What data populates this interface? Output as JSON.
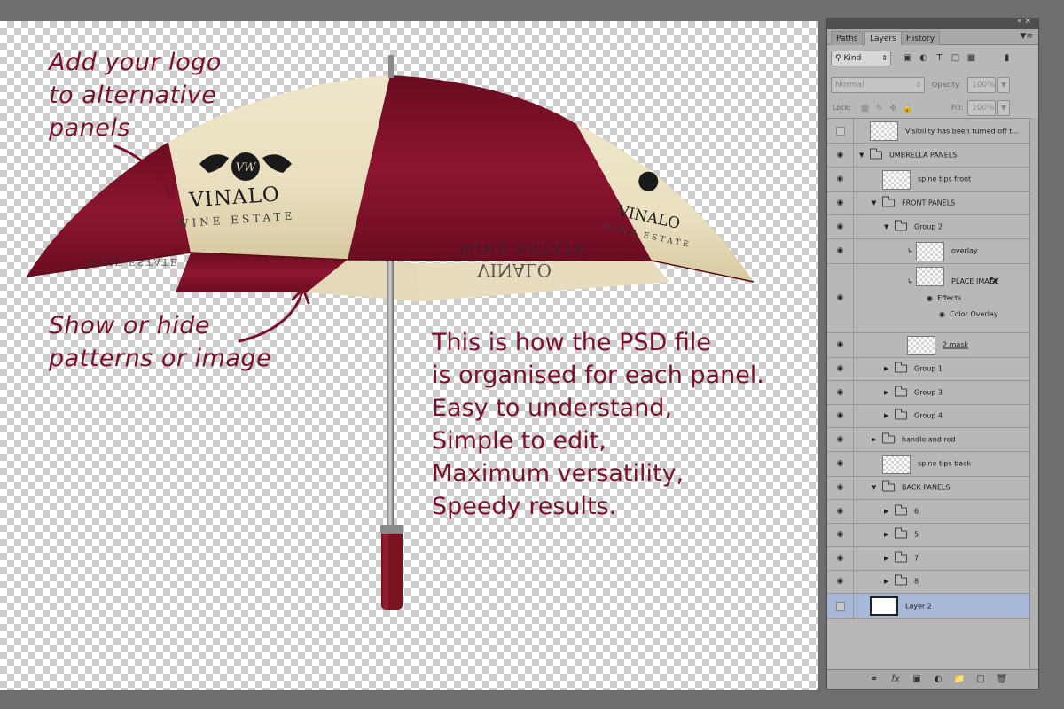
{
  "annotations": {
    "logo_hint": [
      "Add your logo",
      "to alternative",
      "panels"
    ],
    "pattern_hint": [
      "Show or hide",
      "patterns or image"
    ],
    "info": [
      "This is how the PSD file",
      "is organised for each panel.",
      "Easy to understand,",
      "Simple to edit,",
      "Maximum versatility,",
      "Speedy results."
    ]
  },
  "umbrella": {
    "brand": "VINALO",
    "tagline": "WINE ESTATE",
    "monogram": "VW",
    "colors": {
      "maroon": "#7e1128",
      "cream": "#ece2c4",
      "handle": "#7a1222",
      "shaft": "#9a9a9a"
    }
  },
  "panel": {
    "collapse_icon": "double-chevron-icon",
    "tabs": [
      "Paths",
      "Layers",
      "History"
    ],
    "active_tab": "Layers",
    "filter_kind": "Kind",
    "blend_mode": "Normal",
    "opacity_label": "Opacity:",
    "opacity_value": "100%",
    "lock_label": "Lock:",
    "fill_label": "Fill:",
    "fill_value": "100%",
    "layers": [
      {
        "name": "Visibility has been turned off t...",
        "type": "thumb",
        "visible": false,
        "indent": 0
      },
      {
        "name": "UMBRELLA PANELS",
        "type": "group-open",
        "visible": true,
        "indent": 0
      },
      {
        "name": "spine tips front",
        "type": "thumb",
        "visible": true,
        "indent": 1
      },
      {
        "name": "FRONT PANELS",
        "type": "group-open",
        "visible": true,
        "indent": 1
      },
      {
        "name": "Group 2",
        "type": "group-open",
        "visible": true,
        "indent": 2
      },
      {
        "name": "overlay",
        "type": "thumb-clip",
        "visible": true,
        "indent": 3
      },
      {
        "name": "PLACE IMAGE",
        "type": "thumb-clip-fx",
        "visible": true,
        "indent": 3
      },
      {
        "name": "2 mask",
        "type": "thumb-ul",
        "visible": true,
        "indent": 3
      },
      {
        "name": "Group 1",
        "type": "group-closed",
        "visible": true,
        "indent": 2
      },
      {
        "name": "Group 3",
        "type": "group-closed",
        "visible": true,
        "indent": 2
      },
      {
        "name": "Group 4",
        "type": "group-closed",
        "visible": true,
        "indent": 2
      },
      {
        "name": "handle and rod",
        "type": "group-closed",
        "visible": true,
        "indent": 1
      },
      {
        "name": "spine tips back",
        "type": "thumb",
        "visible": true,
        "indent": 1
      },
      {
        "name": "BACK PANELS",
        "type": "group-open",
        "visible": true,
        "indent": 1
      },
      {
        "name": "6",
        "type": "group-closed",
        "visible": true,
        "indent": 2
      },
      {
        "name": "5",
        "type": "group-closed",
        "visible": true,
        "indent": 2
      },
      {
        "name": "7",
        "type": "group-closed",
        "visible": true,
        "indent": 2
      },
      {
        "name": "8",
        "type": "group-closed",
        "visible": true,
        "indent": 2
      },
      {
        "name": "Layer 2",
        "type": "thumb-white",
        "visible": false,
        "indent": 0,
        "selected": true
      }
    ],
    "effects_label": "Effects",
    "color_overlay_label": "Color Overlay"
  }
}
